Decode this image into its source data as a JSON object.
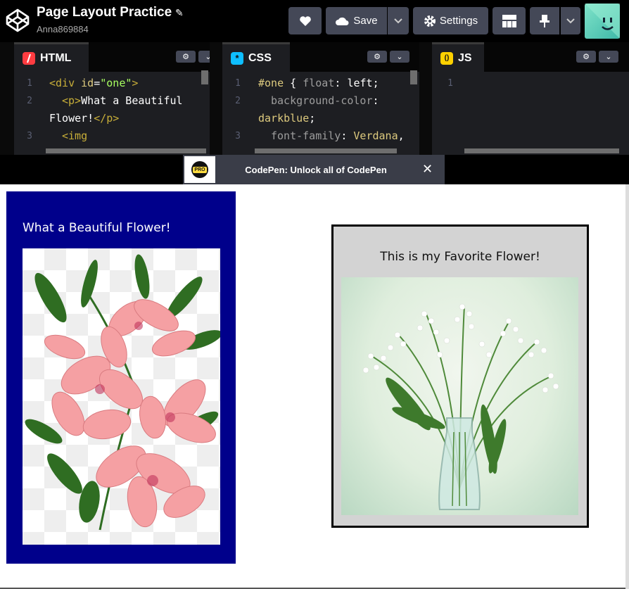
{
  "header": {
    "title": "Page Layout Practice",
    "username": "Anna869884",
    "save_label": "Save",
    "settings_label": "Settings"
  },
  "editors": {
    "html": {
      "label": "HTML",
      "lines": [
        {
          "num": "1",
          "text": "<div id=\"one\">"
        },
        {
          "num": "2",
          "text": "<p>What a Beautiful"
        },
        {
          "num": "",
          "text": "Flower!</p>"
        },
        {
          "num": "3",
          "text": "<img"
        }
      ]
    },
    "css": {
      "label": "CSS",
      "lines": [
        {
          "num": "1",
          "text": "#one { float: left;"
        },
        {
          "num": "2",
          "text": "background-color:"
        },
        {
          "num": "",
          "text": "darkblue;"
        },
        {
          "num": "3",
          "text": "font-family: Verdana,"
        }
      ]
    },
    "js": {
      "label": "JS",
      "lines": [
        {
          "num": "1",
          "text": ""
        }
      ]
    }
  },
  "banner": {
    "badge": "PRO",
    "text": "CodePen: Unlock all of CodePen"
  },
  "preview": {
    "div_one_text": "What a Beautiful Flower!",
    "div_two_text": "This is my Favorite Flower!",
    "div_one_bg": "#00008b",
    "div_two_bg": "#d3d3d3"
  },
  "colors": {
    "topbar": "#000000",
    "button": "#444857",
    "editor_bg": "#1d1e22",
    "html_icon": "#ff3c41",
    "css_icon": "#0ebeff",
    "js_icon": "#fcd000"
  },
  "icons": [
    "codepen-logo-icon",
    "pencil-icon",
    "heart-icon",
    "cloud-icon",
    "chevron-down-icon",
    "gear-icon",
    "layout-icon",
    "pin-icon",
    "avatar",
    "close-icon"
  ]
}
